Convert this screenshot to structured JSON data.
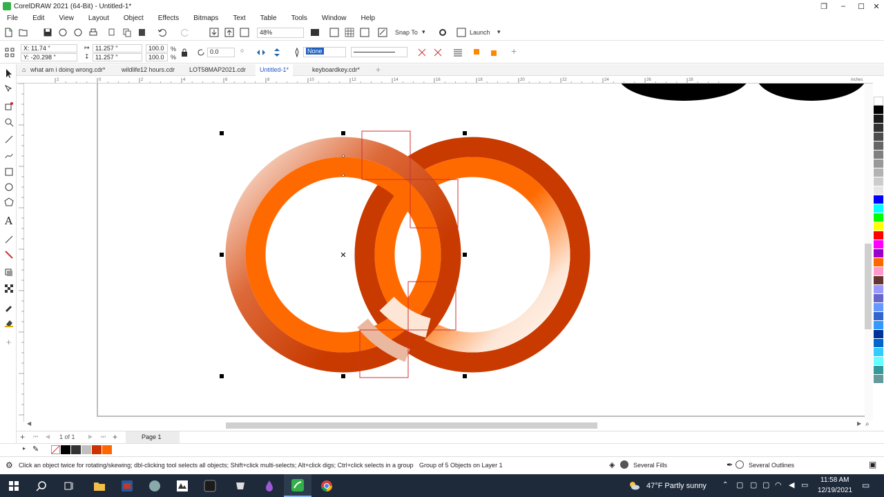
{
  "window": {
    "title": "CorelDRAW 2021 (64-Bit) - Untitled-1*"
  },
  "menu": [
    "File",
    "Edit",
    "View",
    "Layout",
    "Object",
    "Effects",
    "Bitmaps",
    "Text",
    "Table",
    "Tools",
    "Window",
    "Help"
  ],
  "toolbar": {
    "zoom": "48%",
    "snap_to": "Snap To",
    "launch": "Launch"
  },
  "propbar": {
    "x": "X: 11.74 \"",
    "y": "Y: -20.298 \"",
    "width": "11.257 \"",
    "height": "11.257 \"",
    "scale_w": "100.0",
    "scale_h": "100.0",
    "pct": "%",
    "angle": "0.0",
    "outline_width": "None"
  },
  "tabs": [
    "what am i doing wrong.cdr*",
    "wildlife12 hours.cdr",
    "LOT58MAP2021.cdr",
    "Untitled-1*",
    "keyboardkey.cdr*"
  ],
  "active_tab": 3,
  "rulers": {
    "h": [
      "2",
      "0",
      "2",
      "4",
      "6",
      "8",
      "10",
      "12",
      "14",
      "16",
      "18",
      "20",
      "22",
      "24",
      "26",
      "28"
    ],
    "units": "inches"
  },
  "palette": [
    "#ffffff",
    "#000000",
    "#1a1a1a",
    "#333333",
    "#4d4d4d",
    "#666666",
    "#808080",
    "#999999",
    "#b3b3b3",
    "#cccccc",
    "#e6e6e6",
    "#0000ff",
    "#00ffff",
    "#00ff00",
    "#ffff00",
    "#ff0000",
    "#ff00ff",
    "#9900cc",
    "#ff6600",
    "#ff99cc",
    "#663333",
    "#9999ff",
    "#6666cc",
    "#6699ff",
    "#3366cc",
    "#3399ff",
    "#003399",
    "#0066cc",
    "#33ccff",
    "#66ffff",
    "#339999",
    "#669999"
  ],
  "pagebar": {
    "pages": "1 of 1",
    "page_tab": "Page 1"
  },
  "doc_palette": [
    "#000000",
    "#333333",
    "#c0c0c0",
    "#cc3300",
    "#ff6600"
  ],
  "status": {
    "hint": "Click an object twice for rotating/skewing; dbl-clicking tool selects all objects; Shift+click multi-selects; Alt+click digs; Ctrl+click selects in a group",
    "selection": "Group of 5 Objects on Layer 1",
    "fill": "Several Fills",
    "outline": "Several Outlines"
  },
  "taskbar": {
    "weather": "47°F  Partly sunny",
    "time": "11:58 AM",
    "date": "12/19/2021"
  },
  "colors": {
    "ring_dark": "#c83a00",
    "ring_bright": "#ff6a00",
    "highlight": "#fde8da",
    "selection_box": "#d03030"
  }
}
